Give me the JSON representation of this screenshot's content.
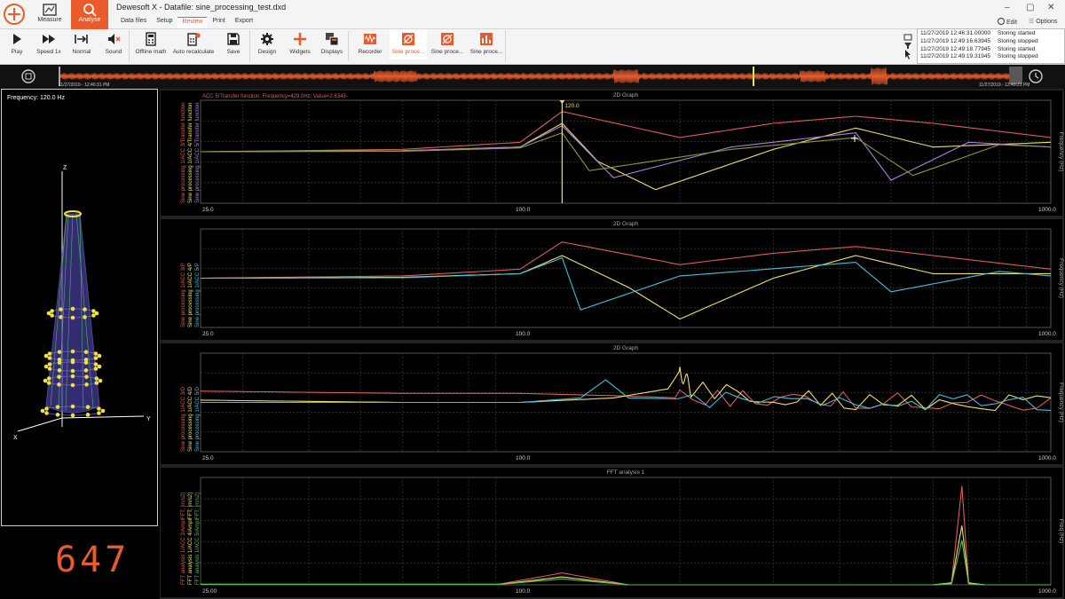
{
  "app": {
    "title": "Dewesoft X - Datafile: sine_processing_test.dxd",
    "modules": [
      {
        "label": "Measure"
      },
      {
        "label": "Analyse"
      }
    ],
    "tabs": [
      {
        "label": "Data files"
      },
      {
        "label": "Setup"
      },
      {
        "label": "Review"
      },
      {
        "label": "Print"
      },
      {
        "label": "Export"
      }
    ],
    "active_tab": "Review",
    "edit_label": "Edit",
    "options_label": "Options",
    "window_controls": {
      "minimize": "–",
      "maximize": "▢",
      "close": "✕"
    }
  },
  "ribbon": {
    "buttons": [
      {
        "label": "Play",
        "icon": "play-icon"
      },
      {
        "label": "Speed 1x",
        "icon": "fast-forward-icon"
      },
      {
        "label": "Normal",
        "icon": "normal-arrow-icon"
      },
      {
        "label": "Sound",
        "icon": "speaker-mute-icon"
      },
      {
        "label": "Offline math",
        "icon": "calculator-icon"
      },
      {
        "label": "Auto recalculate",
        "icon": "calculator-refresh-icon"
      },
      {
        "label": "Save",
        "icon": "floppy-icon"
      },
      {
        "label": "Design",
        "icon": "gear-icon"
      },
      {
        "label": "Widgets",
        "icon": "plus-icon"
      },
      {
        "label": "Displays",
        "icon": "displays-icon"
      },
      {
        "label": "Recorder",
        "icon": "recorder-icon"
      },
      {
        "label": "Sine proce...",
        "icon": "sine-processing-icon"
      },
      {
        "label": "Sine proce...",
        "icon": "sine-processing-icon"
      },
      {
        "label": "Sine proce...",
        "icon": "bar-chart-icon"
      }
    ]
  },
  "event_log": [
    {
      "time": "11/27/2019 12:46:31.00000",
      "text": "Storing started"
    },
    {
      "time": "11/27/2019 12:49:16.63945",
      "text": "Storing stopped"
    },
    {
      "time": "11/27/2019 12:49:18.77945",
      "text": "Storing started"
    },
    {
      "time": "11/27/2019 12:49:19.31945",
      "text": "Storing stopped"
    }
  ],
  "overview": {
    "start_time": "11/27/2019 - 12:46:31 PM",
    "end_time": "11/27/2019 - 12:49:21 PM"
  },
  "geometry": {
    "frequency_label": "Frequency: 120.0 Hz",
    "axis_z": "Z",
    "axis_x": "X",
    "axis_y": "Y"
  },
  "counter": "647",
  "colors": {
    "accent": "#ea5b2c",
    "red": "#e05a5a",
    "yellow": "#f0e060",
    "cyan": "#40c0e0",
    "purple": "#b080e0",
    "green": "#50c050",
    "olive": "#8a9a30",
    "grid": "#333333"
  },
  "graphs": [
    {
      "title": "2D Graph",
      "cursor_readout": "ACC 5/Transfer function; Frequency=429.0Hz; Value=2.6343-",
      "cursor_label": "120.0",
      "channels": [
        "Sine processing 1/ACC 3/Transfer function",
        "Sine processing 1/ACC 4/Transfer function",
        "Sine processing 1/ACC 5/Transfer function"
      ],
      "y_axis_label": "Frequency (Hz)"
    },
    {
      "title": "2D Graph",
      "channels": [
        "Sine processing 1/ACC 3/P",
        "Sine processing 1/ACC 4/P",
        "Sine processing 1/ACC 5/P"
      ],
      "y_axis_label": "Frequency (Hz)"
    },
    {
      "title": "2D Graph",
      "channels": [
        "Sine processing 1/ACC 3/D",
        "Sine processing 1/ACC 4/D",
        "Sine processing 1/ACC 5/D"
      ],
      "y_axis_label": "Frequency (Hz)"
    },
    {
      "title": "FFT analysis 1",
      "channels": [
        "FFT analysis 1/ACC 3/AmplFFT; [m/s2]",
        "FFT analysis 1/ACC 4/AmplFFT; [m/s2]",
        "FFT analysis 1/ACC 5/AmplFFT; [m/s2]"
      ],
      "y_axis_label": "Freq (Hz)"
    }
  ],
  "chart_data": [
    {
      "type": "line",
      "title": "2D Graph",
      "ylabel": "Frequency (Hz)",
      "x_scale": "log",
      "xlim": [
        25,
        1000
      ],
      "x_ticks": [
        "25.0",
        "100.0",
        "1000.0"
      ],
      "ylim": [
        -1,
        1
      ],
      "grid": true,
      "series": [
        {
          "color": "#e05a5a",
          "x": [
            25,
            60,
            100,
            120,
            200,
            300,
            429,
            600,
            1000
          ],
          "values": [
            0.0,
            0.05,
            0.2,
            0.85,
            0.3,
            0.6,
            0.75,
            0.6,
            0.3
          ]
        },
        {
          "color": "#f0e060",
          "x": [
            25,
            60,
            100,
            120,
            140,
            180,
            300,
            429,
            600,
            1000
          ],
          "values": [
            0.0,
            0.02,
            0.1,
            0.6,
            -0.2,
            -0.8,
            0.05,
            0.5,
            0.1,
            0.2
          ]
        },
        {
          "color": "#b080e0",
          "x": [
            25,
            60,
            100,
            120,
            150,
            250,
            429,
            500,
            700,
            1000
          ],
          "values": [
            0.0,
            0.02,
            0.1,
            0.55,
            -0.55,
            0.1,
            0.4,
            -0.6,
            0.2,
            0.1
          ]
        },
        {
          "color": "#8a9a30",
          "x": [
            25,
            60,
            100,
            120,
            135,
            250,
            429,
            550,
            800,
            1000
          ],
          "values": [
            0.0,
            0.01,
            0.08,
            0.4,
            -0.4,
            0.05,
            0.3,
            -0.5,
            0.15,
            0.1
          ]
        }
      ]
    },
    {
      "type": "line",
      "title": "2D Graph",
      "ylabel": "Frequency (Hz)",
      "x_scale": "log",
      "xlim": [
        25,
        1000
      ],
      "x_ticks": [
        "25.0",
        "100.0",
        "1000.0"
      ],
      "ylim": [
        -1,
        1
      ],
      "grid": true,
      "series": [
        {
          "color": "#e05a5a",
          "x": [
            25,
            60,
            100,
            120,
            200,
            300,
            429,
            600,
            1000
          ],
          "values": [
            0.0,
            0.05,
            0.2,
            0.8,
            0.3,
            0.55,
            0.7,
            0.5,
            0.2
          ]
        },
        {
          "color": "#f0e060",
          "x": [
            25,
            60,
            100,
            120,
            160,
            200,
            300,
            429,
            600,
            1000
          ],
          "values": [
            0.0,
            0.02,
            0.1,
            0.5,
            -0.2,
            -0.9,
            0.0,
            0.5,
            0.1,
            0.1
          ]
        },
        {
          "color": "#40c0e0",
          "x": [
            25,
            60,
            100,
            120,
            130,
            200,
            429,
            500,
            800,
            1000
          ],
          "values": [
            0.0,
            0.01,
            0.1,
            0.45,
            -0.7,
            0.05,
            0.35,
            -0.3,
            0.15,
            0.05
          ]
        }
      ]
    },
    {
      "type": "line",
      "title": "2D Graph",
      "ylabel": "Frequency (Hz)",
      "x_scale": "log",
      "xlim": [
        25,
        1000
      ],
      "x_ticks": [
        "25.0",
        "100.0",
        "1000.0"
      ],
      "ylim": [
        -1,
        1
      ],
      "grid": true,
      "series": [
        {
          "color": "#e05a5a",
          "x": [
            25,
            60,
            100,
            150,
            200,
            429,
            1000
          ],
          "values": [
            0.25,
            0.2,
            0.2,
            0.15,
            0.1,
            0.05,
            0.0
          ]
        },
        {
          "color": "#f0e060",
          "x": [
            25,
            60,
            100,
            150,
            190,
            200,
            210,
            429,
            1000
          ],
          "values": [
            0.05,
            0.0,
            0.0,
            0.1,
            0.3,
            0.7,
            0.3,
            0.0,
            0.0
          ]
        },
        {
          "color": "#40c0e0",
          "x": [
            25,
            60,
            100,
            130,
            145,
            160,
            429,
            1000
          ],
          "values": [
            0.0,
            0.0,
            0.0,
            0.1,
            0.5,
            0.1,
            0.0,
            0.0
          ]
        }
      ]
    },
    {
      "type": "line",
      "title": "FFT analysis 1",
      "ylabel": "Freq (Hz)",
      "x_scale": "log",
      "xlim": [
        25,
        1000
      ],
      "x_ticks": [
        "25.00",
        "100.0",
        "1000.0"
      ],
      "ylim": [
        0,
        1
      ],
      "grid": true,
      "series": [
        {
          "color": "#e05a5a",
          "x": [
            25,
            90,
            120,
            160,
            600,
            650,
            680,
            700,
            750,
            1000
          ],
          "values": [
            0.0,
            0.0,
            0.12,
            0.0,
            0.0,
            0.02,
            1.0,
            0.02,
            0.0,
            0.0
          ]
        },
        {
          "color": "#f0e060",
          "x": [
            25,
            90,
            120,
            160,
            600,
            650,
            680,
            700,
            750,
            1000
          ],
          "values": [
            0.0,
            0.0,
            0.08,
            0.0,
            0.0,
            0.02,
            0.6,
            0.02,
            0.0,
            0.0
          ]
        },
        {
          "color": "#50c050",
          "x": [
            25,
            90,
            120,
            160,
            600,
            650,
            680,
            700,
            750,
            1000
          ],
          "values": [
            0.0,
            0.0,
            0.06,
            0.0,
            0.0,
            0.01,
            0.45,
            0.01,
            0.0,
            0.0
          ]
        }
      ]
    }
  ]
}
